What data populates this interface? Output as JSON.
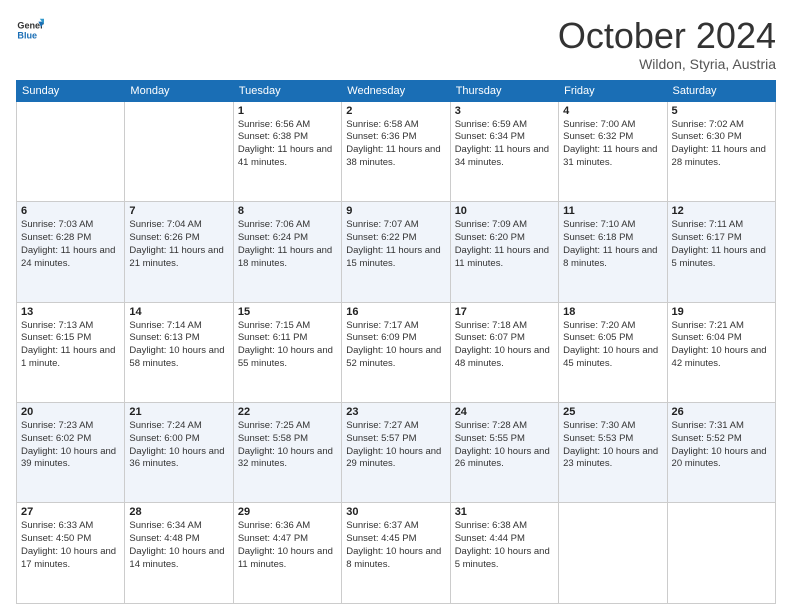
{
  "header": {
    "logo_line1": "General",
    "logo_line2": "Blue",
    "month": "October 2024",
    "location": "Wildon, Styria, Austria"
  },
  "weekdays": [
    "Sunday",
    "Monday",
    "Tuesday",
    "Wednesday",
    "Thursday",
    "Friday",
    "Saturday"
  ],
  "weeks": [
    [
      {
        "day": "",
        "info": ""
      },
      {
        "day": "",
        "info": ""
      },
      {
        "day": "1",
        "info": "Sunrise: 6:56 AM\nSunset: 6:38 PM\nDaylight: 11 hours and 41 minutes."
      },
      {
        "day": "2",
        "info": "Sunrise: 6:58 AM\nSunset: 6:36 PM\nDaylight: 11 hours and 38 minutes."
      },
      {
        "day": "3",
        "info": "Sunrise: 6:59 AM\nSunset: 6:34 PM\nDaylight: 11 hours and 34 minutes."
      },
      {
        "day": "4",
        "info": "Sunrise: 7:00 AM\nSunset: 6:32 PM\nDaylight: 11 hours and 31 minutes."
      },
      {
        "day": "5",
        "info": "Sunrise: 7:02 AM\nSunset: 6:30 PM\nDaylight: 11 hours and 28 minutes."
      }
    ],
    [
      {
        "day": "6",
        "info": "Sunrise: 7:03 AM\nSunset: 6:28 PM\nDaylight: 11 hours and 24 minutes."
      },
      {
        "day": "7",
        "info": "Sunrise: 7:04 AM\nSunset: 6:26 PM\nDaylight: 11 hours and 21 minutes."
      },
      {
        "day": "8",
        "info": "Sunrise: 7:06 AM\nSunset: 6:24 PM\nDaylight: 11 hours and 18 minutes."
      },
      {
        "day": "9",
        "info": "Sunrise: 7:07 AM\nSunset: 6:22 PM\nDaylight: 11 hours and 15 minutes."
      },
      {
        "day": "10",
        "info": "Sunrise: 7:09 AM\nSunset: 6:20 PM\nDaylight: 11 hours and 11 minutes."
      },
      {
        "day": "11",
        "info": "Sunrise: 7:10 AM\nSunset: 6:18 PM\nDaylight: 11 hours and 8 minutes."
      },
      {
        "day": "12",
        "info": "Sunrise: 7:11 AM\nSunset: 6:17 PM\nDaylight: 11 hours and 5 minutes."
      }
    ],
    [
      {
        "day": "13",
        "info": "Sunrise: 7:13 AM\nSunset: 6:15 PM\nDaylight: 11 hours and 1 minute."
      },
      {
        "day": "14",
        "info": "Sunrise: 7:14 AM\nSunset: 6:13 PM\nDaylight: 10 hours and 58 minutes."
      },
      {
        "day": "15",
        "info": "Sunrise: 7:15 AM\nSunset: 6:11 PM\nDaylight: 10 hours and 55 minutes."
      },
      {
        "day": "16",
        "info": "Sunrise: 7:17 AM\nSunset: 6:09 PM\nDaylight: 10 hours and 52 minutes."
      },
      {
        "day": "17",
        "info": "Sunrise: 7:18 AM\nSunset: 6:07 PM\nDaylight: 10 hours and 48 minutes."
      },
      {
        "day": "18",
        "info": "Sunrise: 7:20 AM\nSunset: 6:05 PM\nDaylight: 10 hours and 45 minutes."
      },
      {
        "day": "19",
        "info": "Sunrise: 7:21 AM\nSunset: 6:04 PM\nDaylight: 10 hours and 42 minutes."
      }
    ],
    [
      {
        "day": "20",
        "info": "Sunrise: 7:23 AM\nSunset: 6:02 PM\nDaylight: 10 hours and 39 minutes."
      },
      {
        "day": "21",
        "info": "Sunrise: 7:24 AM\nSunset: 6:00 PM\nDaylight: 10 hours and 36 minutes."
      },
      {
        "day": "22",
        "info": "Sunrise: 7:25 AM\nSunset: 5:58 PM\nDaylight: 10 hours and 32 minutes."
      },
      {
        "day": "23",
        "info": "Sunrise: 7:27 AM\nSunset: 5:57 PM\nDaylight: 10 hours and 29 minutes."
      },
      {
        "day": "24",
        "info": "Sunrise: 7:28 AM\nSunset: 5:55 PM\nDaylight: 10 hours and 26 minutes."
      },
      {
        "day": "25",
        "info": "Sunrise: 7:30 AM\nSunset: 5:53 PM\nDaylight: 10 hours and 23 minutes."
      },
      {
        "day": "26",
        "info": "Sunrise: 7:31 AM\nSunset: 5:52 PM\nDaylight: 10 hours and 20 minutes."
      }
    ],
    [
      {
        "day": "27",
        "info": "Sunrise: 6:33 AM\nSunset: 4:50 PM\nDaylight: 10 hours and 17 minutes."
      },
      {
        "day": "28",
        "info": "Sunrise: 6:34 AM\nSunset: 4:48 PM\nDaylight: 10 hours and 14 minutes."
      },
      {
        "day": "29",
        "info": "Sunrise: 6:36 AM\nSunset: 4:47 PM\nDaylight: 10 hours and 11 minutes."
      },
      {
        "day": "30",
        "info": "Sunrise: 6:37 AM\nSunset: 4:45 PM\nDaylight: 10 hours and 8 minutes."
      },
      {
        "day": "31",
        "info": "Sunrise: 6:38 AM\nSunset: 4:44 PM\nDaylight: 10 hours and 5 minutes."
      },
      {
        "day": "",
        "info": ""
      },
      {
        "day": "",
        "info": ""
      }
    ]
  ]
}
